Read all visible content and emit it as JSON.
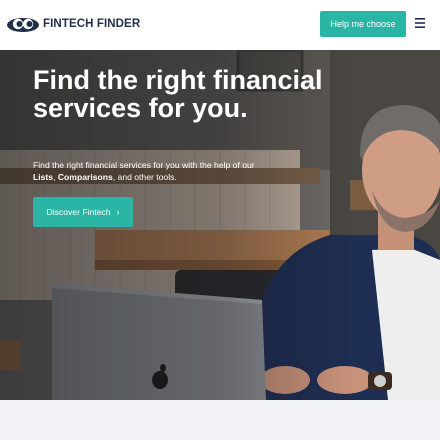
{
  "header": {
    "brand": "FINTECH FINDER",
    "cta_label": "Help me choose"
  },
  "hero": {
    "title": "Find the right financial services for you.",
    "subtitle_prefix": "Find the right financial services for you with the help of our",
    "subtitle_link_lists": "Lists",
    "subtitle_sep": ", ",
    "subtitle_link_comparisons": "Comparisons",
    "subtitle_suffix": ", and other tools.",
    "button_label": "Discover Fintech",
    "button_icon": "chevron-right-icon"
  },
  "colors": {
    "accent": "#2bb5a4",
    "brand_text": "#1f2f4a",
    "footer_strip": "#f2f3f7"
  }
}
